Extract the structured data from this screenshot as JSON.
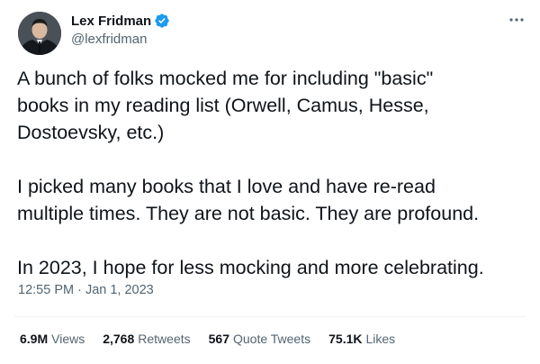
{
  "author": {
    "display_name": "Lex Fridman",
    "handle": "@lexfridman",
    "verified": true,
    "avatar_icon": "profile-photo"
  },
  "menu": {
    "icon": "more-options-icon"
  },
  "tweet": {
    "paragraphs": [
      [
        "A bunch of folks mocked me for including \"basic\"",
        "books in my reading list (Orwell, Camus, Hesse,",
        "Dostoevsky, etc.)"
      ],
      [
        "I picked many books that I love and have re-read",
        "multiple times. They are not basic. They are profound."
      ],
      [
        "In 2023, I hope for less mocking and more celebrating."
      ]
    ],
    "timestamp": "12:55 PM · Jan 1, 2023"
  },
  "stats": {
    "views": {
      "count": "6.9M",
      "label": "Views"
    },
    "retweets": {
      "count": "2,768",
      "label": "Retweets"
    },
    "quote_tweets": {
      "count": "567",
      "label": "Quote Tweets"
    },
    "likes": {
      "count": "75.1K",
      "label": "Likes"
    }
  },
  "colors": {
    "verified_badge": "#1d9bf0",
    "text_primary": "#0f1419",
    "text_secondary": "#536471",
    "divider": "#eff3f4"
  }
}
